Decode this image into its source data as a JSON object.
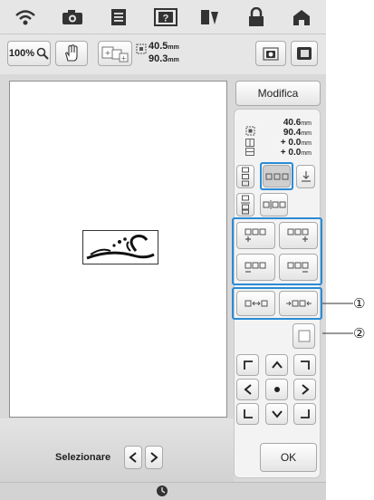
{
  "toolbar": {
    "zoom_value": "100%",
    "size_width": "40.5",
    "size_height": "90.3",
    "unit": "mm"
  },
  "panel": {
    "edit_label": "Modifica",
    "size_width": "40.6",
    "size_height": "90.4",
    "offset_x": "+ 0.0",
    "offset_y": "+ 0.0",
    "unit": "mm",
    "ok_label": "OK"
  },
  "bottom": {
    "select_label": "Selezionare"
  },
  "callouts": [
    "①",
    "②"
  ],
  "colors": {
    "highlight": "#2a8bd6"
  },
  "icons": [
    "wifi-icon",
    "camera-icon",
    "document-icon",
    "help-icon",
    "thread-icon",
    "lock-icon",
    "home-icon",
    "zoom-magnifier-icon",
    "hand-pan-icon",
    "scan-camera-icon",
    "screen-icon",
    "clock-icon"
  ]
}
